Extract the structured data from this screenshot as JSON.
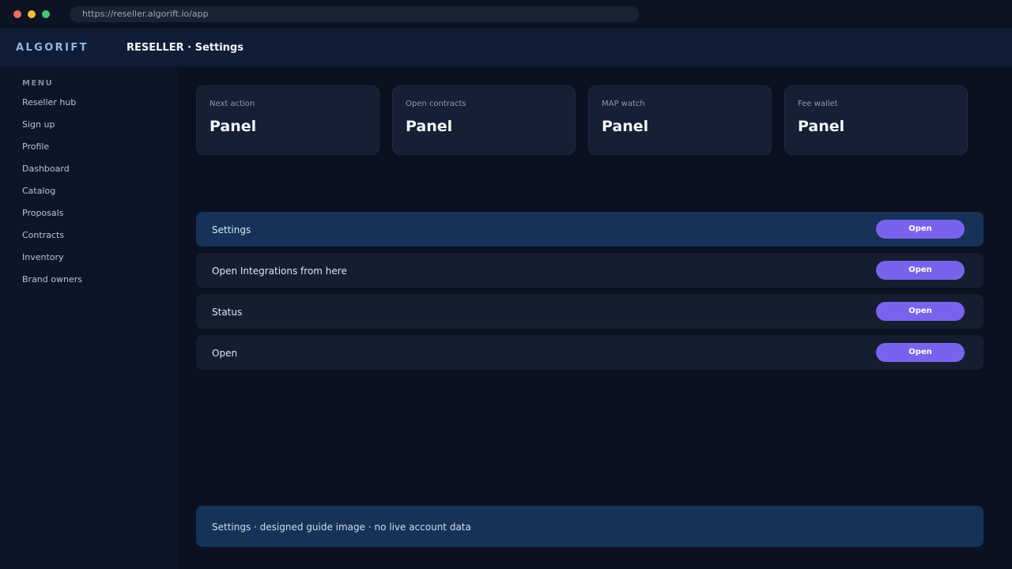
{
  "browser": {
    "url": "https://reseller.algorift.io/app"
  },
  "header": {
    "brand": "ALGORIFT",
    "title": "RESELLER · Settings"
  },
  "sidebar": {
    "heading": "MENU",
    "items": [
      {
        "label": "Reseller hub"
      },
      {
        "label": "Sign up"
      },
      {
        "label": "Profile"
      },
      {
        "label": "Dashboard"
      },
      {
        "label": "Catalog"
      },
      {
        "label": "Proposals"
      },
      {
        "label": "Contracts"
      },
      {
        "label": "Inventory"
      },
      {
        "label": "Brand owners"
      }
    ]
  },
  "cards": [
    {
      "label": "Next action",
      "value": "Panel"
    },
    {
      "label": "Open contracts",
      "value": "Panel"
    },
    {
      "label": "MAP watch",
      "value": "Panel"
    },
    {
      "label": "Fee wallet",
      "value": "Panel"
    }
  ],
  "rows": [
    {
      "label": "Settings",
      "button": "Open",
      "active": true
    },
    {
      "label": "Open Integrations from here",
      "button": "Open",
      "active": false
    },
    {
      "label": "Status",
      "button": "Open",
      "active": false
    },
    {
      "label": "Open",
      "button": "Open",
      "active": false
    }
  ],
  "footer": {
    "note": "Settings · designed guide image · no live account data"
  },
  "colors": {
    "accent": "#7a63ec",
    "active_row": "#163259",
    "brand": "#93b6e6"
  }
}
